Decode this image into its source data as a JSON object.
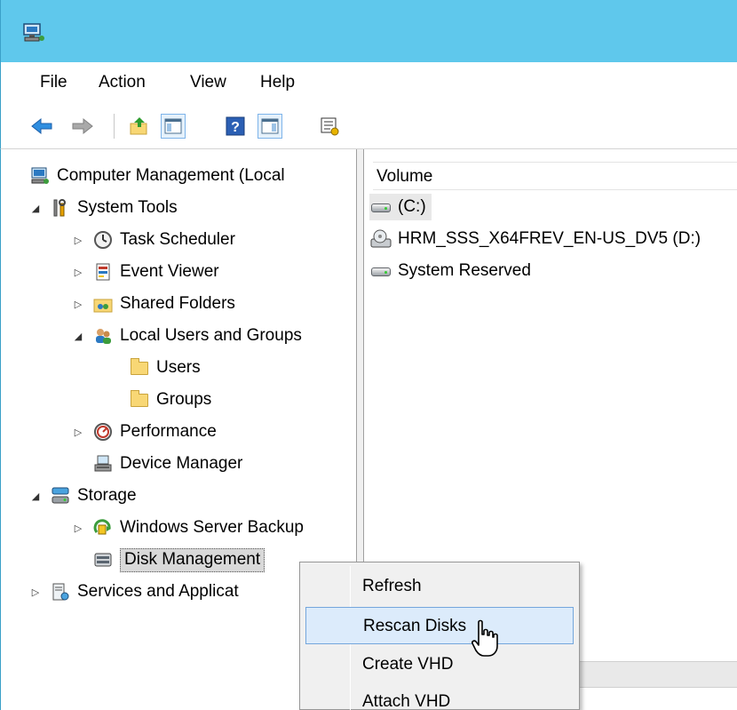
{
  "menu": {
    "file": "File",
    "action": "Action",
    "view": "View",
    "help": "Help"
  },
  "toolbar": {
    "back": "back-icon",
    "forward": "forward-icon",
    "up": "up-folder-icon",
    "show_hide_tree": "console-tree-icon",
    "help": "help-icon",
    "show_hide_action": "action-pane-icon",
    "properties": "properties-icon"
  },
  "tree": {
    "root": "Computer Management (Local",
    "system_tools": "System Tools",
    "task_scheduler": "Task Scheduler",
    "event_viewer": "Event Viewer",
    "shared_folders": "Shared Folders",
    "local_users_groups": "Local Users and Groups",
    "users": "Users",
    "groups": "Groups",
    "performance": "Performance",
    "device_manager": "Device Manager",
    "storage": "Storage",
    "windows_server_backup": "Windows Server Backup",
    "disk_management": "Disk Management",
    "services_apps": "Services and Applicat"
  },
  "volumes": {
    "header": "Volume",
    "rows": [
      "(C:)",
      "HRM_SSS_X64FREV_EN-US_DV5 (D:)",
      "System Reserved"
    ]
  },
  "context_menu": {
    "items": [
      "Refresh",
      "Rescan Disks",
      "Create VHD",
      "Attach VHD"
    ]
  },
  "colors": {
    "titlebar": "#5fc8ec",
    "highlight": "#dcebfb",
    "highlight_border": "#74a6dc"
  }
}
